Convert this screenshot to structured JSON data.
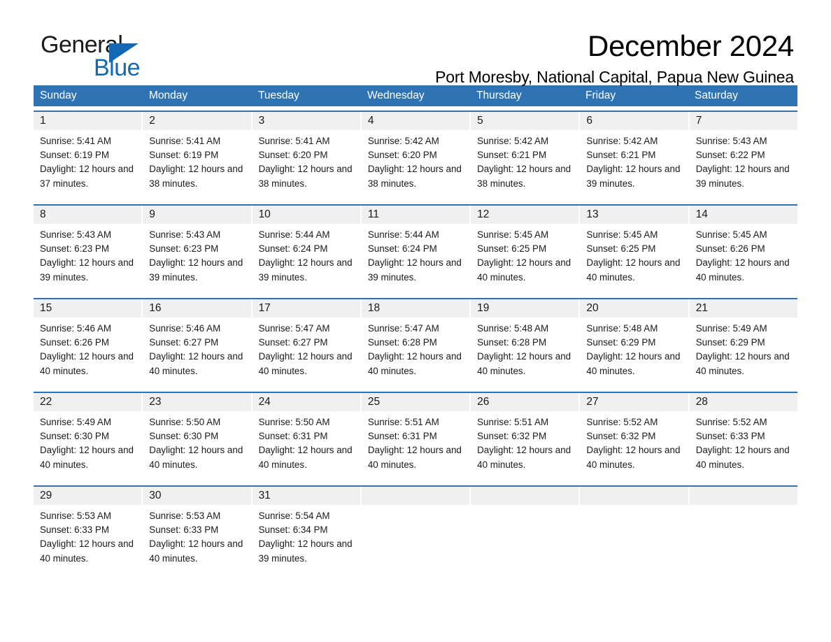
{
  "brand": {
    "name_part1": "General",
    "name_part2": "Blue",
    "triangle_color": "#1268b3"
  },
  "header": {
    "title": "December 2024",
    "location": "Port Moresby, National Capital, Papua New Guinea"
  },
  "theme": {
    "header_blue": "#2e74b5",
    "daynum_bg": "#f0f0f0",
    "text": "#1a1a1a",
    "page_bg": "#ffffff"
  },
  "weekday_headers": [
    "Sunday",
    "Monday",
    "Tuesday",
    "Wednesday",
    "Thursday",
    "Friday",
    "Saturday"
  ],
  "weeks": [
    {
      "days": [
        {
          "num": "1",
          "sunrise": "Sunrise: 5:41 AM",
          "sunset": "Sunset: 6:19 PM",
          "daylight": "Daylight: 12 hours and 37 minutes."
        },
        {
          "num": "2",
          "sunrise": "Sunrise: 5:41 AM",
          "sunset": "Sunset: 6:19 PM",
          "daylight": "Daylight: 12 hours and 38 minutes."
        },
        {
          "num": "3",
          "sunrise": "Sunrise: 5:41 AM",
          "sunset": "Sunset: 6:20 PM",
          "daylight": "Daylight: 12 hours and 38 minutes."
        },
        {
          "num": "4",
          "sunrise": "Sunrise: 5:42 AM",
          "sunset": "Sunset: 6:20 PM",
          "daylight": "Daylight: 12 hours and 38 minutes."
        },
        {
          "num": "5",
          "sunrise": "Sunrise: 5:42 AM",
          "sunset": "Sunset: 6:21 PM",
          "daylight": "Daylight: 12 hours and 38 minutes."
        },
        {
          "num": "6",
          "sunrise": "Sunrise: 5:42 AM",
          "sunset": "Sunset: 6:21 PM",
          "daylight": "Daylight: 12 hours and 39 minutes."
        },
        {
          "num": "7",
          "sunrise": "Sunrise: 5:43 AM",
          "sunset": "Sunset: 6:22 PM",
          "daylight": "Daylight: 12 hours and 39 minutes."
        }
      ]
    },
    {
      "days": [
        {
          "num": "8",
          "sunrise": "Sunrise: 5:43 AM",
          "sunset": "Sunset: 6:23 PM",
          "daylight": "Daylight: 12 hours and 39 minutes."
        },
        {
          "num": "9",
          "sunrise": "Sunrise: 5:43 AM",
          "sunset": "Sunset: 6:23 PM",
          "daylight": "Daylight: 12 hours and 39 minutes."
        },
        {
          "num": "10",
          "sunrise": "Sunrise: 5:44 AM",
          "sunset": "Sunset: 6:24 PM",
          "daylight": "Daylight: 12 hours and 39 minutes."
        },
        {
          "num": "11",
          "sunrise": "Sunrise: 5:44 AM",
          "sunset": "Sunset: 6:24 PM",
          "daylight": "Daylight: 12 hours and 39 minutes."
        },
        {
          "num": "12",
          "sunrise": "Sunrise: 5:45 AM",
          "sunset": "Sunset: 6:25 PM",
          "daylight": "Daylight: 12 hours and 40 minutes."
        },
        {
          "num": "13",
          "sunrise": "Sunrise: 5:45 AM",
          "sunset": "Sunset: 6:25 PM",
          "daylight": "Daylight: 12 hours and 40 minutes."
        },
        {
          "num": "14",
          "sunrise": "Sunrise: 5:45 AM",
          "sunset": "Sunset: 6:26 PM",
          "daylight": "Daylight: 12 hours and 40 minutes."
        }
      ]
    },
    {
      "days": [
        {
          "num": "15",
          "sunrise": "Sunrise: 5:46 AM",
          "sunset": "Sunset: 6:26 PM",
          "daylight": "Daylight: 12 hours and 40 minutes."
        },
        {
          "num": "16",
          "sunrise": "Sunrise: 5:46 AM",
          "sunset": "Sunset: 6:27 PM",
          "daylight": "Daylight: 12 hours and 40 minutes."
        },
        {
          "num": "17",
          "sunrise": "Sunrise: 5:47 AM",
          "sunset": "Sunset: 6:27 PM",
          "daylight": "Daylight: 12 hours and 40 minutes."
        },
        {
          "num": "18",
          "sunrise": "Sunrise: 5:47 AM",
          "sunset": "Sunset: 6:28 PM",
          "daylight": "Daylight: 12 hours and 40 minutes."
        },
        {
          "num": "19",
          "sunrise": "Sunrise: 5:48 AM",
          "sunset": "Sunset: 6:28 PM",
          "daylight": "Daylight: 12 hours and 40 minutes."
        },
        {
          "num": "20",
          "sunrise": "Sunrise: 5:48 AM",
          "sunset": "Sunset: 6:29 PM",
          "daylight": "Daylight: 12 hours and 40 minutes."
        },
        {
          "num": "21",
          "sunrise": "Sunrise: 5:49 AM",
          "sunset": "Sunset: 6:29 PM",
          "daylight": "Daylight: 12 hours and 40 minutes."
        }
      ]
    },
    {
      "days": [
        {
          "num": "22",
          "sunrise": "Sunrise: 5:49 AM",
          "sunset": "Sunset: 6:30 PM",
          "daylight": "Daylight: 12 hours and 40 minutes."
        },
        {
          "num": "23",
          "sunrise": "Sunrise: 5:50 AM",
          "sunset": "Sunset: 6:30 PM",
          "daylight": "Daylight: 12 hours and 40 minutes."
        },
        {
          "num": "24",
          "sunrise": "Sunrise: 5:50 AM",
          "sunset": "Sunset: 6:31 PM",
          "daylight": "Daylight: 12 hours and 40 minutes."
        },
        {
          "num": "25",
          "sunrise": "Sunrise: 5:51 AM",
          "sunset": "Sunset: 6:31 PM",
          "daylight": "Daylight: 12 hours and 40 minutes."
        },
        {
          "num": "26",
          "sunrise": "Sunrise: 5:51 AM",
          "sunset": "Sunset: 6:32 PM",
          "daylight": "Daylight: 12 hours and 40 minutes."
        },
        {
          "num": "27",
          "sunrise": "Sunrise: 5:52 AM",
          "sunset": "Sunset: 6:32 PM",
          "daylight": "Daylight: 12 hours and 40 minutes."
        },
        {
          "num": "28",
          "sunrise": "Sunrise: 5:52 AM",
          "sunset": "Sunset: 6:33 PM",
          "daylight": "Daylight: 12 hours and 40 minutes."
        }
      ]
    },
    {
      "days": [
        {
          "num": "29",
          "sunrise": "Sunrise: 5:53 AM",
          "sunset": "Sunset: 6:33 PM",
          "daylight": "Daylight: 12 hours and 40 minutes."
        },
        {
          "num": "30",
          "sunrise": "Sunrise: 5:53 AM",
          "sunset": "Sunset: 6:33 PM",
          "daylight": "Daylight: 12 hours and 40 minutes."
        },
        {
          "num": "31",
          "sunrise": "Sunrise: 5:54 AM",
          "sunset": "Sunset: 6:34 PM",
          "daylight": "Daylight: 12 hours and 39 minutes."
        },
        {
          "num": "",
          "sunrise": "",
          "sunset": "",
          "daylight": ""
        },
        {
          "num": "",
          "sunrise": "",
          "sunset": "",
          "daylight": ""
        },
        {
          "num": "",
          "sunrise": "",
          "sunset": "",
          "daylight": ""
        },
        {
          "num": "",
          "sunrise": "",
          "sunset": "",
          "daylight": ""
        }
      ]
    }
  ]
}
